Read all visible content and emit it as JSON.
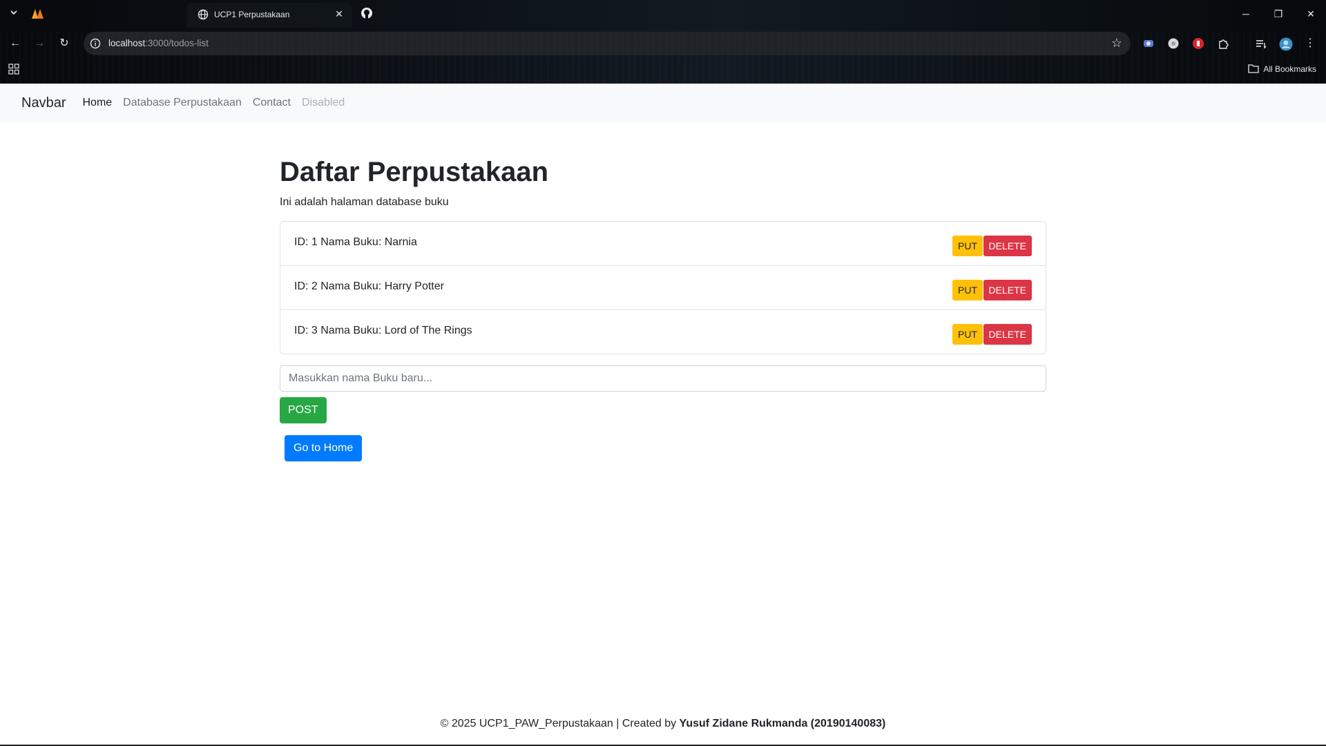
{
  "browser": {
    "tab_title": "UCP1 Perpustakaan",
    "url_host": "localhost",
    "url_path": ":3000/todos-list",
    "bookmarks_label": "All Bookmarks"
  },
  "navbar": {
    "brand": "Navbar",
    "links": [
      {
        "label": "Home",
        "state": "active"
      },
      {
        "label": "Database Perpustakaan",
        "state": "normal"
      },
      {
        "label": "Contact",
        "state": "normal"
      },
      {
        "label": "Disabled",
        "state": "disabled"
      }
    ]
  },
  "main": {
    "title": "Daftar Perpustakaan",
    "subtitle": "Ini adalah halaman database buku",
    "books": [
      {
        "text": "ID: 1 Nama Buku: Narnia",
        "put_label": "PUT",
        "delete_label": "DELETE"
      },
      {
        "text": "ID: 2 Nama Buku: Harry Potter",
        "put_label": "PUT",
        "delete_label": "DELETE"
      },
      {
        "text": "ID: 3 Nama Buku: Lord of The Rings",
        "put_label": "PUT",
        "delete_label": "DELETE"
      }
    ],
    "new_book_placeholder": "Masukkan nama Buku baru...",
    "post_label": "POST",
    "home_label": "Go to Home"
  },
  "footer": {
    "prefix": "© 2025 UCP1_PAW_Perpustakaan | Created by ",
    "author": "Yusuf Zidane Rukmanda (20190140083)"
  },
  "colors": {
    "put": "#ffc107",
    "delete": "#dc3545",
    "post": "#28a745",
    "home": "#007bff",
    "navbar_bg": "#f8f9fa"
  }
}
